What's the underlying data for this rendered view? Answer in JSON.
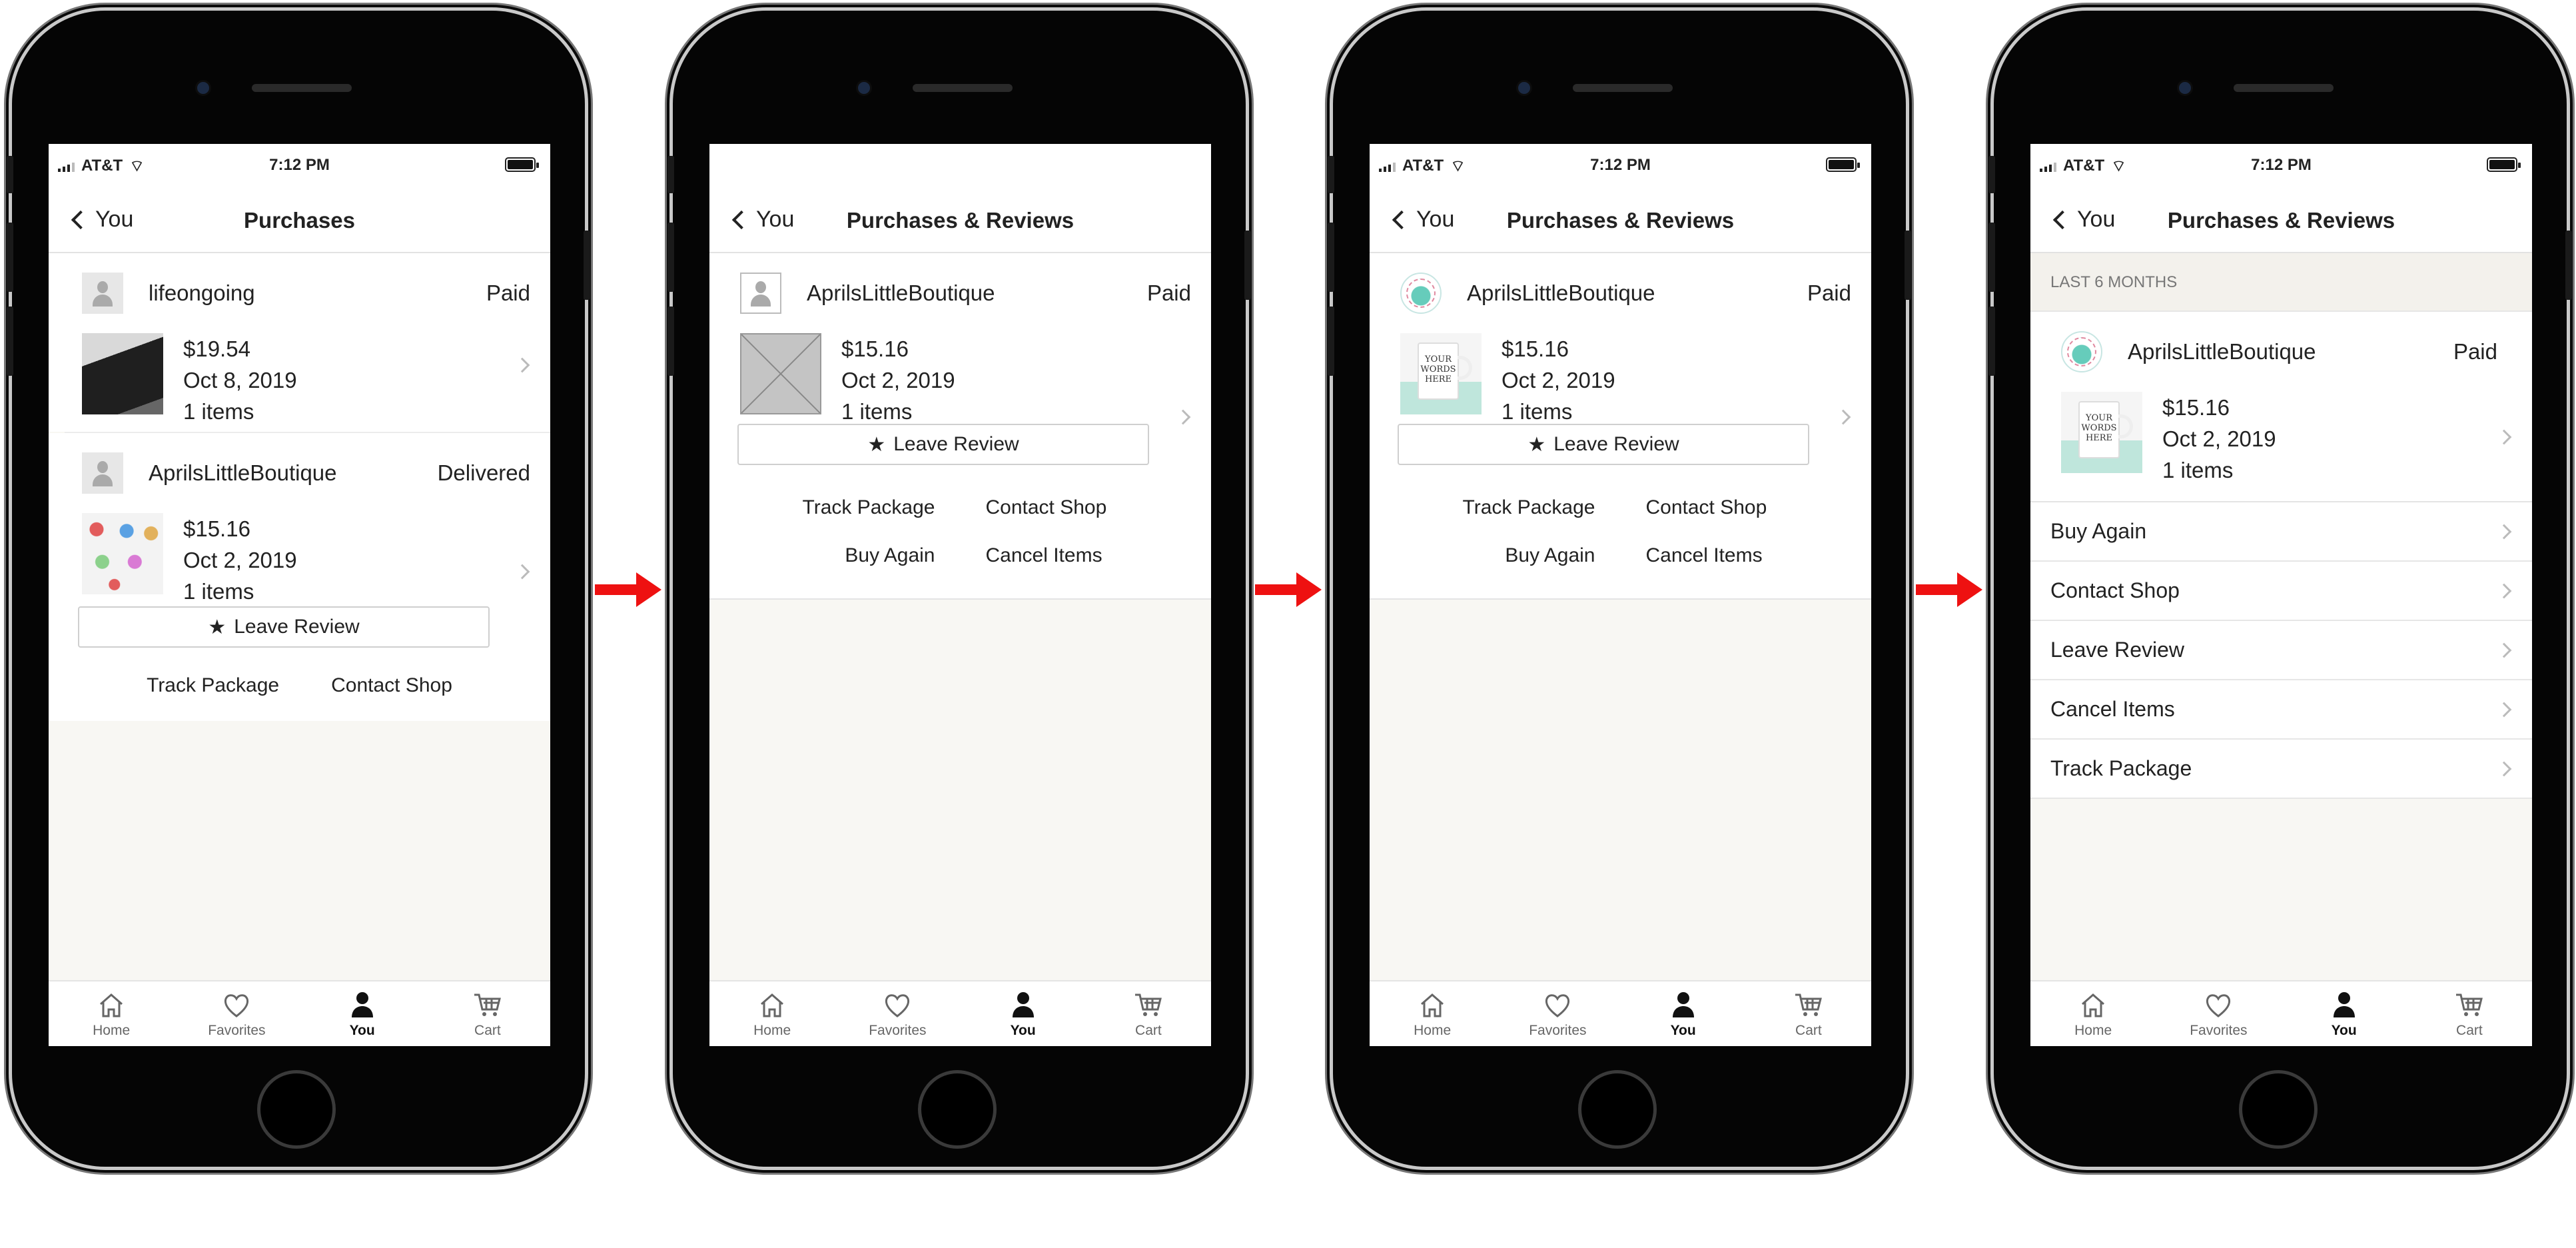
{
  "status_bar": {
    "carrier": "AT&T",
    "time": "7:12 PM"
  },
  "tabs": [
    {
      "label": "Home",
      "icon": "home-icon"
    },
    {
      "label": "Favorites",
      "icon": "heart-icon"
    },
    {
      "label": "You",
      "icon": "person-icon"
    },
    {
      "label": "Cart",
      "icon": "cart-icon"
    }
  ],
  "accent_color": "#ee1111",
  "screens": [
    {
      "back_label": "You",
      "title": "Purchases",
      "orders": [
        {
          "shop": "lifeongoing",
          "status": "Paid",
          "price": "$19.54",
          "date": "Oct 8, 2019",
          "items": "1 items"
        },
        {
          "shop": "AprilsLittleBoutique",
          "status": "Delivered",
          "price": "$15.16",
          "date": "Oct 2, 2019",
          "items": "1 items",
          "review_label": "Leave Review",
          "actions": [
            "Track Package",
            "Contact Shop"
          ]
        }
      ]
    },
    {
      "back_label": "You",
      "title": "Purchases & Reviews",
      "order": {
        "shop": "AprilsLittleBoutique",
        "status": "Paid",
        "price": "$15.16",
        "date": "Oct 2, 2019",
        "items": "1 items",
        "review_label": "Leave Review",
        "actions": [
          "Track Package",
          "Contact Shop",
          "Buy Again",
          "Cancel Items"
        ]
      }
    },
    {
      "back_label": "You",
      "title": "Purchases & Reviews",
      "order": {
        "shop": "AprilsLittleBoutique",
        "status": "Paid",
        "price": "$15.16",
        "date": "Oct 2, 2019",
        "items": "1 items",
        "review_label": "Leave Review",
        "actions": [
          "Track Package",
          "Contact Shop",
          "Buy Again",
          "Cancel Items"
        ]
      },
      "mug_text": "YOUR WORDS HERE"
    },
    {
      "back_label": "You",
      "title": "Purchases & Reviews",
      "section": "LAST 6 MONTHS",
      "order": {
        "shop": "AprilsLittleBoutique",
        "status": "Paid",
        "price": "$15.16",
        "date": "Oct 2, 2019",
        "items": "1 items"
      },
      "mug_text": "YOUR WORDS HERE",
      "menu": [
        "Buy Again",
        "Contact Shop",
        "Leave Review",
        "Cancel Items",
        "Track Package"
      ]
    }
  ]
}
